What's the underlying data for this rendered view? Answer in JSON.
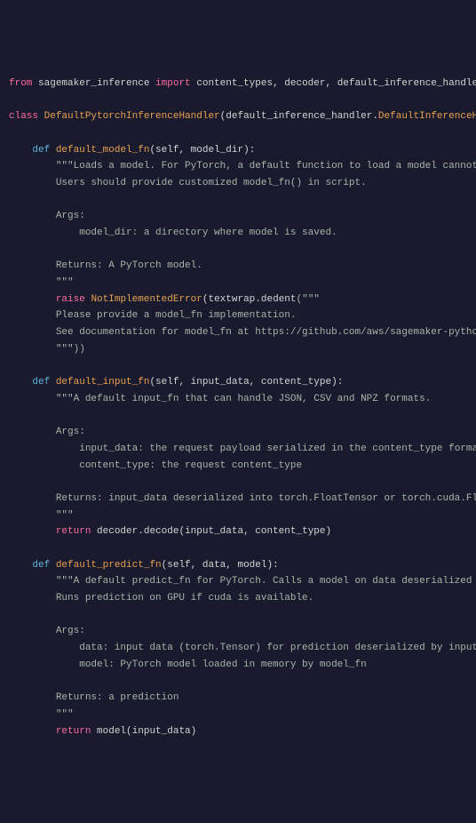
{
  "code": {
    "line1": {
      "from": "from",
      "module": "sagemaker_inference",
      "import": "import",
      "imports": "content_types, decoder, default_inference_handler, encoder, errors"
    },
    "line2": {
      "class": "class",
      "name": "DefaultPytorchInferenceHandler",
      "parent_module": "default_inference_handler",
      "dot": ".",
      "parent_class": "DefaultInferenceHandler",
      "colon": "):"
    },
    "fn1": {
      "def": "def",
      "name": "default_model_fn",
      "params": "(self, model_dir):",
      "doc1": "\"\"\"Loads a model. For PyTorch, a default function to load a model cannot be provided.",
      "doc2": "Users should provide customized model_fn() in script.",
      "args_label": "Args:",
      "arg1": "model_dir: a directory where model is saved.",
      "returns": "Returns: A PyTorch model.",
      "doc_end": "\"\"\"",
      "raise": "raise",
      "error": "NotImplementedError",
      "textwrap": "textwrap",
      "dedent": "dedent",
      "quote_open": "(\"\"\"",
      "msg1": "Please provide a model_fn implementation.",
      "msg2": "See documentation for model_fn at https://github.com/aws/sagemaker-python-sdk",
      "quote_close": "\"\"\"))"
    },
    "fn2": {
      "def": "def",
      "name": "default_input_fn",
      "params": "(self, input_data, content_type):",
      "doc1": "\"\"\"A default input_fn that can handle JSON, CSV and NPZ formats.",
      "args_label": "Args:",
      "arg1": "input_data: the request payload serialized in the content_type format",
      "arg2": "content_type: the request content_type",
      "returns": "Returns: input_data deserialized into torch.FloatTensor or torch.cuda.FloatTensor depending if cu",
      "doc_end": "\"\"\"",
      "return": "return",
      "decoder": "decoder",
      "decode": "decode",
      "call_args": "(input_data, content_type)"
    },
    "fn3": {
      "def": "def",
      "name": "default_predict_fn",
      "params": "(self, data, model):",
      "doc1": "\"\"\"A default predict_fn for PyTorch. Calls a model on data deserialized in input_fn.",
      "doc2": "Runs prediction on GPU if cuda is available.",
      "args_label": "Args:",
      "arg1": "data: input data (torch.Tensor) for prediction deserialized by input_fn",
      "arg2": "model: PyTorch model loaded in memory by model_fn",
      "returns": "Returns: a prediction",
      "doc_end": "\"\"\"",
      "return": "return",
      "call": "model(input_data)"
    }
  }
}
